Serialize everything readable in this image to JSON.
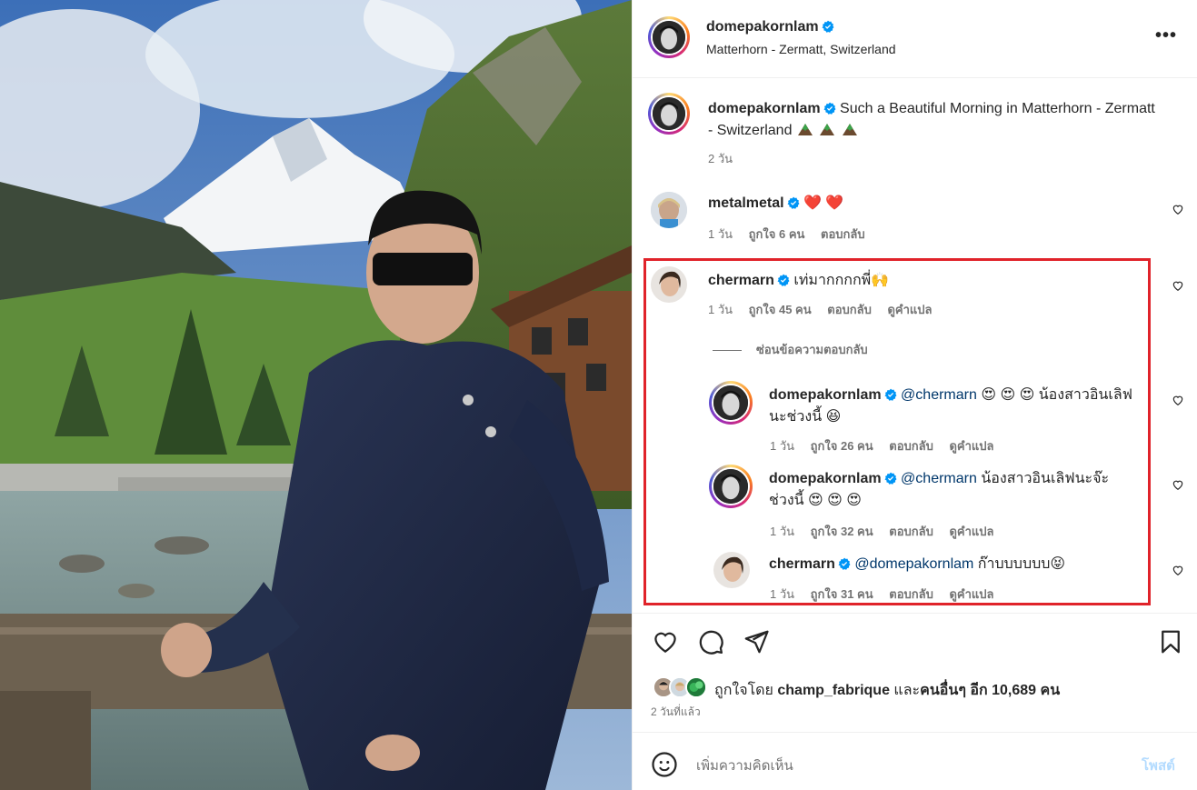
{
  "post": {
    "author": "domepakornlam",
    "location": "Matterhorn - Zermatt, Switzerland",
    "more_icon": "more-horizontal-icon",
    "caption": {
      "username": "domepakornlam",
      "text": "Such a Beautiful Morning in Matterhorn - Zermatt - Switzerland",
      "emojis": "mountain-emoji x3",
      "time": "2 วัน"
    }
  },
  "comments": [
    {
      "username": "metalmetal",
      "text": "❤️ ❤️",
      "time": "1 วัน",
      "likes": "ถูกใจ 6 คน",
      "reply": "ตอบกลับ"
    },
    {
      "username": "chermarn",
      "text": "เท่มากกกกพี่🙌",
      "time": "1 วัน",
      "likes": "ถูกใจ 45 คน",
      "reply": "ตอบกลับ",
      "translate": "ดูคำแปล",
      "hidden_replies": "ซ่อนข้อความตอบกลับ",
      "replies": [
        {
          "username": "domepakornlam",
          "mention": "@chermarn",
          "text_a": "😍 😍 😍",
          "text_b": "น้องสาวอินเลิฟนะช่วงนี้ 😆",
          "time": "1 วัน",
          "likes": "ถูกใจ 26 คน",
          "reply": "ตอบกลับ",
          "translate": "ดูคำแปล"
        },
        {
          "username": "domepakornlam",
          "mention": "@chermarn",
          "text_a": "น้องสาวอินเลิฟนะจ๊ะช่วงนี้",
          "text_b": "😍 😍 😍",
          "time": "1 วัน",
          "likes": "ถูกใจ 32 คน",
          "reply": "ตอบกลับ",
          "translate": "ดูคำแปล"
        },
        {
          "username": "chermarn",
          "mention": "@domepakornlam",
          "text_a": "ก๊าบบบบบบ😝",
          "text_b": "",
          "time": "1 วัน",
          "likes": "ถูกใจ 31 คน",
          "reply": "ตอบกลับ",
          "translate": "ดูคำแปล"
        }
      ]
    }
  ],
  "actions": {
    "like_icon": "heart-icon",
    "comment_icon": "comment-icon",
    "share_icon": "share-icon",
    "save_icon": "bookmark-icon"
  },
  "likes_line": {
    "prefix": "ถูกใจโดย",
    "user": "champ_fabrique",
    "and": "และ",
    "others": "คนอื่นๆ อีก 10,689 คน"
  },
  "posted_ago": "2 วันที่แล้ว",
  "composer": {
    "placeholder": "เพิ่มความคิดเห็น",
    "post_label": "โพสต์",
    "emoji_icon": "smiley-icon"
  },
  "colors": {
    "verified": "#0095f6",
    "highlight_border": "#e0232a",
    "mention": "#00376b",
    "post_disabled": "#b3dbff"
  }
}
